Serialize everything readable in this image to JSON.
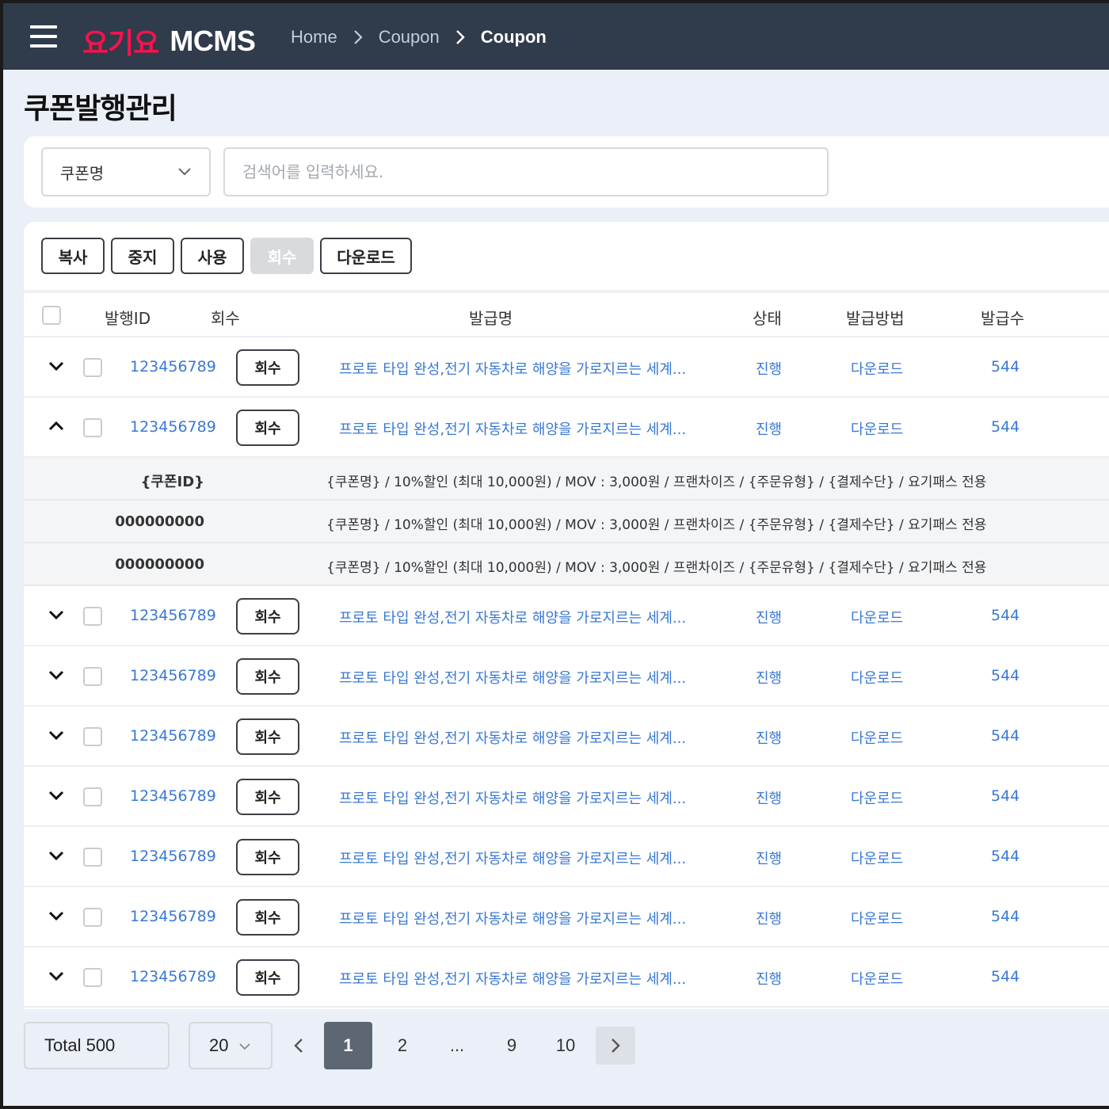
{
  "header": {
    "brand_ko": "요기요",
    "brand_en": "MCMS",
    "breadcrumbs": [
      "Home",
      "Coupon",
      "Coupon"
    ]
  },
  "page": {
    "title": "쿠폰발행관리"
  },
  "search": {
    "field_selected": "쿠폰명",
    "placeholder": "검색어를 입력하세요."
  },
  "toolbar": {
    "copy": "복사",
    "stop": "중지",
    "use": "사용",
    "revoke": "회수",
    "download": "다운로드"
  },
  "table": {
    "headers": {
      "id": "발행ID",
      "revoke": "회수",
      "name": "발급명",
      "status": "상태",
      "method": "발급방법",
      "count": "발급수"
    },
    "rows": [
      {
        "id": "123456789",
        "btn": "회수",
        "name": "프로토 타입 완성,전기 자동차로 해양을 가로지르는 세계...",
        "status": "진행",
        "method": "다운로드",
        "count": "544",
        "expanded": false
      },
      {
        "id": "123456789",
        "btn": "회수",
        "name": "프로토 타입 완성,전기 자동차로 해양을 가로지르는 세계...",
        "status": "진행",
        "method": "다운로드",
        "count": "544",
        "expanded": true
      },
      {
        "id": "123456789",
        "btn": "회수",
        "name": "프로토 타입 완성,전기 자동차로 해양을 가로지르는 세계...",
        "status": "진행",
        "method": "다운로드",
        "count": "544",
        "expanded": false
      },
      {
        "id": "123456789",
        "btn": "회수",
        "name": "프로토 타입 완성,전기 자동차로 해양을 가로지르는 세계...",
        "status": "진행",
        "method": "다운로드",
        "count": "544",
        "expanded": false
      },
      {
        "id": "123456789",
        "btn": "회수",
        "name": "프로토 타입 완성,전기 자동차로 해양을 가로지르는 세계...",
        "status": "진행",
        "method": "다운로드",
        "count": "544",
        "expanded": false
      },
      {
        "id": "123456789",
        "btn": "회수",
        "name": "프로토 타입 완성,전기 자동차로 해양을 가로지르는 세계...",
        "status": "진행",
        "method": "다운로드",
        "count": "544",
        "expanded": false
      },
      {
        "id": "123456789",
        "btn": "회수",
        "name": "프로토 타입 완성,전기 자동차로 해양을 가로지르는 세계...",
        "status": "진행",
        "method": "다운로드",
        "count": "544",
        "expanded": false
      },
      {
        "id": "123456789",
        "btn": "회수",
        "name": "프로토 타입 완성,전기 자동차로 해양을 가로지르는 세계...",
        "status": "진행",
        "method": "다운로드",
        "count": "544",
        "expanded": false
      },
      {
        "id": "123456789",
        "btn": "회수",
        "name": "프로토 타입 완성,전기 자동차로 해양을 가로지르는 세계...",
        "status": "진행",
        "method": "다운로드",
        "count": "544",
        "expanded": false
      }
    ],
    "sub_rows": [
      {
        "id": "{쿠폰ID}",
        "desc": "{쿠폰명} / 10%할인 (최대 10,000원) / MOV : 3,000원 / 프랜차이즈 / {주문유형} / {결제수단} / 요기패스 전용"
      },
      {
        "id": "000000000",
        "desc": "{쿠폰명} / 10%할인 (최대 10,000원) / MOV : 3,000원 / 프랜차이즈 / {주문유형} / {결제수단} / 요기패스 전용"
      },
      {
        "id": "000000000",
        "desc": "{쿠폰명} / 10%할인 (최대 10,000원) / MOV : 3,000원 / 프랜차이즈 / {주문유형} / {결제수단} / 요기패스 전용"
      }
    ]
  },
  "pagination": {
    "total": "Total 500",
    "page_size": "20",
    "pages": [
      "1",
      "2",
      "...",
      "9",
      "10"
    ],
    "current": "1"
  },
  "colors": {
    "header_bg": "#303b4b",
    "brand_red": "#f5134d",
    "link_blue": "#3978d3",
    "page_bg": "#ebeff7"
  }
}
